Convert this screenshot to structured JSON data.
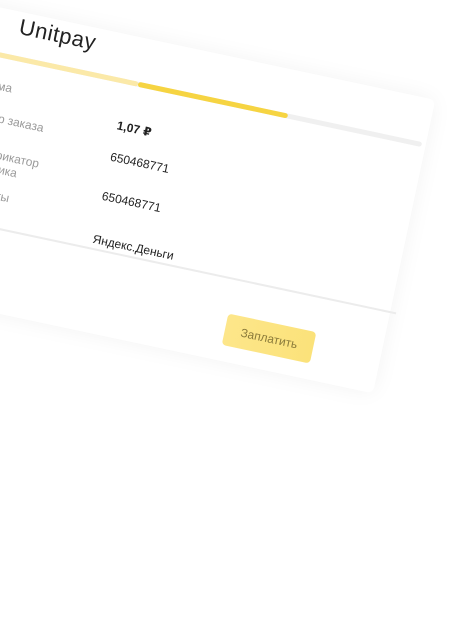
{
  "header": {
    "title": "Unitpay"
  },
  "progress": {
    "completed_fraction": 0.33,
    "current_fraction": 0.67
  },
  "fields": [
    {
      "label": "Сумма",
      "value": "1,07 ₽"
    },
    {
      "label": "Номер заказа",
      "value": "650468771"
    },
    {
      "label": "Идентификатор плательщика",
      "label_line1": "дентификатор",
      "label_line2": "ательщика",
      "value": "650468771"
    },
    {
      "label": "об оплаты",
      "value": "Яндекс.Деньги"
    }
  ],
  "actions": {
    "pay_label": "Заплатить"
  },
  "colors": {
    "accent": "#f6d442",
    "accent_light": "#fbe9a8",
    "button": "#fde68a"
  }
}
